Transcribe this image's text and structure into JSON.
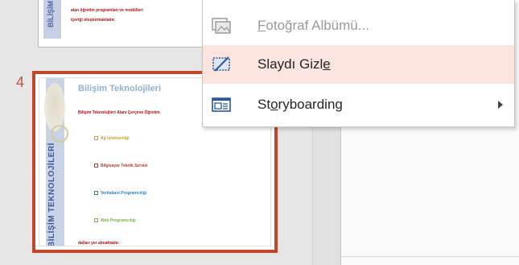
{
  "thumbnails": {
    "prev_slide": {
      "band_label": "BİLİŞİM",
      "line1": "alan öğretim programları ve modülleri",
      "line2": "içeriği oluşturmaktadır."
    },
    "current_slide": {
      "number": "4",
      "title": "Bilişim Teknolojileri",
      "band_label": "BİLİŞİM TEKNOLOJİLERİ",
      "intro": "Bilişim Teknolojileri Alanı Çerçeve Öğretim",
      "items": [
        {
          "text": "Ağ İşletmenliği",
          "color": "#c9a227"
        },
        {
          "text": "Bilgisayar Teknik Servisi",
          "color": "#c0392b"
        },
        {
          "text": "Veritabanı Programcılığı",
          "color": "#2e86c1"
        },
        {
          "text": "Web Programcılığı",
          "color": "#7cb342"
        }
      ],
      "footer": "dalları yer almaktadır."
    }
  },
  "context_menu": {
    "items": [
      {
        "label_pre": "",
        "label_ul": "F",
        "label_post": "otoğraf Albümü...",
        "icon": "photo-album-icon",
        "disabled": true,
        "hover": false,
        "submenu": false
      },
      {
        "label_pre": "Slaydı Gizl",
        "label_ul": "e",
        "label_post": "",
        "icon": "hide-slide-icon",
        "disabled": false,
        "hover": true,
        "submenu": false
      },
      {
        "label_pre": "St",
        "label_ul": "o",
        "label_post": "ryboarding",
        "icon": "storyboarding-icon",
        "disabled": false,
        "hover": false,
        "submenu": true
      }
    ]
  },
  "colors": {
    "selection_border": "#c0492d",
    "hover_bg": "#fbe4dd",
    "band": "#c9d3e6"
  }
}
